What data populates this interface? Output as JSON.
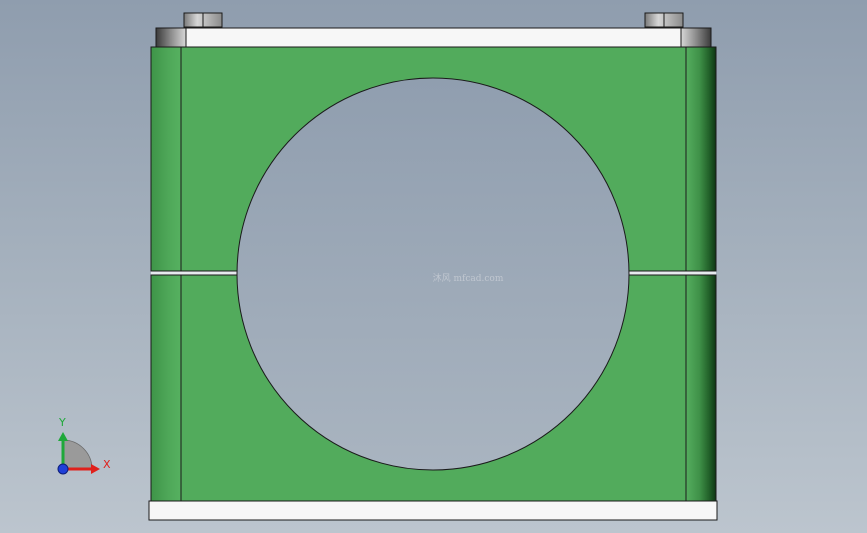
{
  "viewport": {
    "background_top": "#8f9dae",
    "background_bottom": "#bcc5ce"
  },
  "model": {
    "clamp_body_color": "#52ab5c",
    "clamp_edge_color": "#2f7d3a",
    "plate_color": "#f5f5f5",
    "bolt_color": "#b8b8b8",
    "outline_color": "#1a1a1a"
  },
  "watermark": {
    "text": "沐风 mfcad.com"
  },
  "triad": {
    "x_label": "X",
    "y_label": "Y",
    "x_color": "#e0201b",
    "y_color": "#1fa83a",
    "z_color": "#1f3fd8"
  }
}
